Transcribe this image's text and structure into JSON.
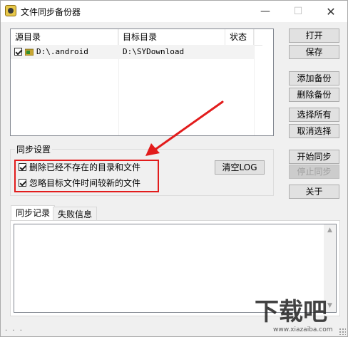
{
  "window": {
    "title": "文件同步备份器"
  },
  "titlebar": {
    "minimize": "—",
    "maximize": "☐",
    "close": "✕"
  },
  "list": {
    "columns": [
      "源目录",
      "目标目录",
      "状态"
    ],
    "rows": [
      {
        "checked": true,
        "source": "D:\\.android",
        "target": "D:\\SYDownload",
        "status": ""
      }
    ]
  },
  "buttons": {
    "open": "打开",
    "save": "保存",
    "add_backup": "添加备份",
    "delete_backup": "删除备份",
    "select_all": "选择所有",
    "cancel_select": "取消选择",
    "start_sync": "开始同步",
    "stop_sync": "停止同步",
    "about": "关于",
    "clear_log": "清空LOG"
  },
  "sync_settings": {
    "legend": "同步设置",
    "options": [
      {
        "label": "删除已经不存在的目录和文件",
        "checked": true
      },
      {
        "label": "忽略目标文件时间较新的文件",
        "checked": true
      }
    ]
  },
  "tabs": [
    {
      "label": "同步记录",
      "active": true
    },
    {
      "label": "失败信息",
      "active": false
    }
  ],
  "status": {
    "text": ". . ."
  },
  "watermark": {
    "text": "下载吧",
    "url_text": "www.xiazaiba.com"
  },
  "colors": {
    "annotation_red": "#e21c1c",
    "accent": "#0078d7"
  }
}
